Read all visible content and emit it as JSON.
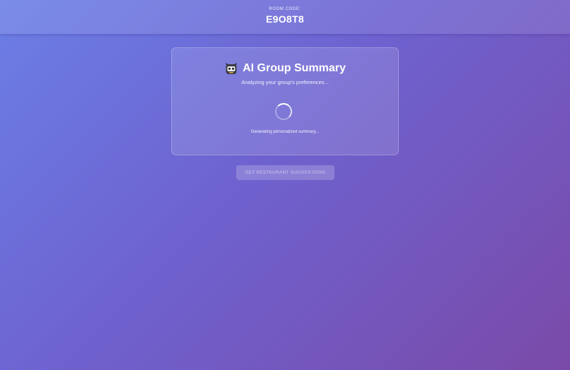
{
  "header": {
    "room_label": "ROOM CODE:",
    "room_code": "E9O8T8"
  },
  "summary_card": {
    "icon": "robot-icon",
    "title": "AI Group Summary",
    "subtitle": "Analyzing your group's preferences...",
    "loading_text": "Generating personalized summary..."
  },
  "actions": {
    "suggest_label": "GET RESTAURANT SUGGESTIONS",
    "suggest_enabled": false
  },
  "colors": {
    "background_start": "#6b7fe6",
    "background_end": "#7a4aa8",
    "text": "#ffffff"
  }
}
